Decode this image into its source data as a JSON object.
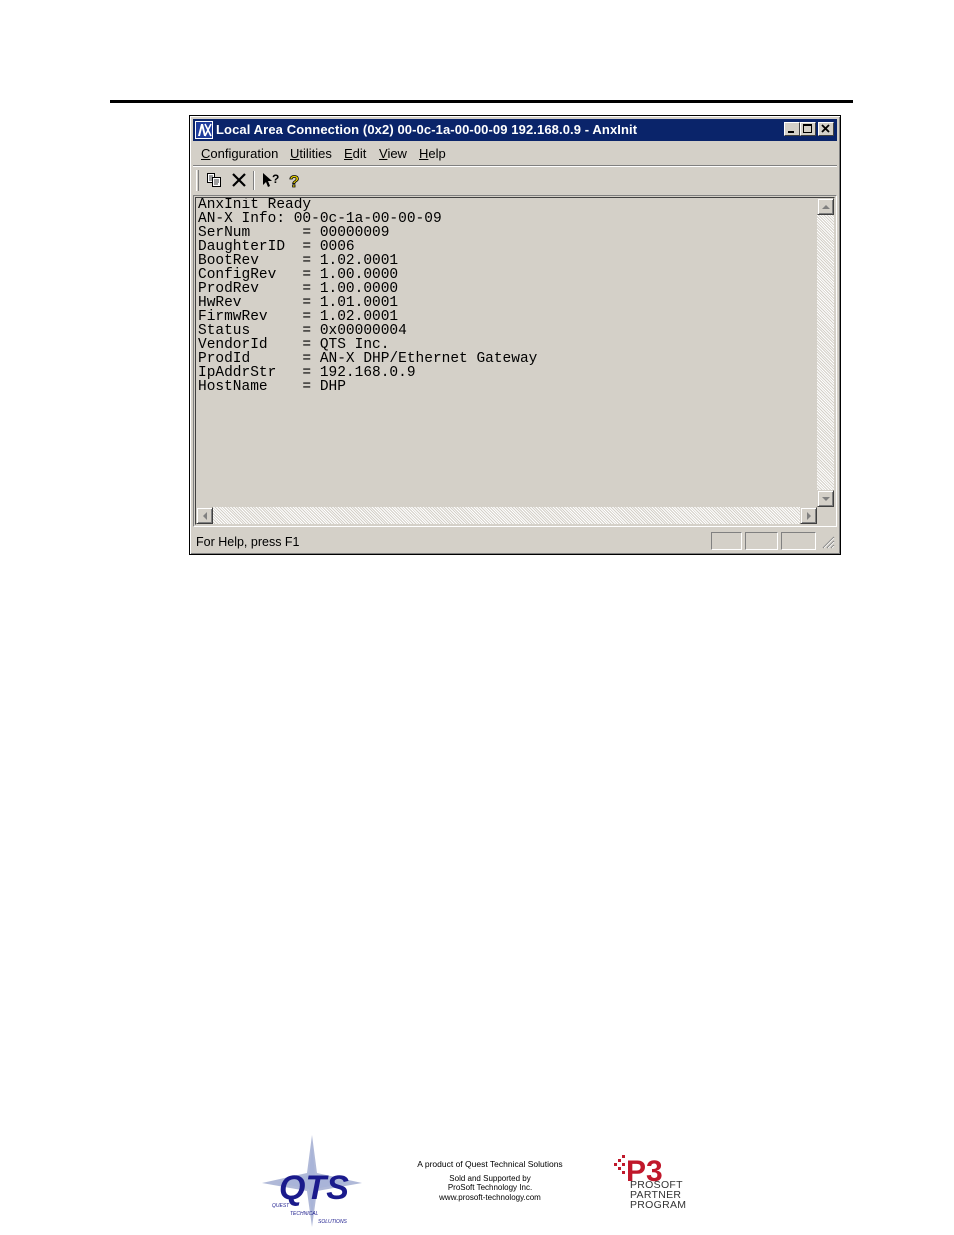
{
  "window": {
    "title": "Local Area Connection (0x2) 00-0c-1a-00-00-09  192.168.0.9 - AnxInit"
  },
  "menu": [
    {
      "pre": "",
      "key": "C",
      "post": "onfiguration"
    },
    {
      "pre": "",
      "key": "U",
      "post": "tilities"
    },
    {
      "pre": "",
      "key": "E",
      "post": "dit"
    },
    {
      "pre": "",
      "key": "V",
      "post": "iew"
    },
    {
      "pre": "",
      "key": "H",
      "post": "elp"
    }
  ],
  "toolbar": {
    "icons": [
      "copy-icon",
      "delete-icon",
      "context-help-icon",
      "help-icon"
    ]
  },
  "output": {
    "lines": [
      "AnxInit Ready",
      "AN-X Info: 00-0c-1a-00-00-09",
      "SerNum      = 00000009",
      "DaughterID  = 0006",
      "BootRev     = 1.02.0001",
      "ConfigRev   = 1.00.0000",
      "ProdRev     = 1.00.0000",
      "HwRev       = 1.01.0001",
      "FirmwRev    = 1.02.0001",
      "Status      = 0x00000004",
      "VendorId    = QTS Inc.",
      "ProdId      = AN-X DHP/Ethernet Gateway",
      "IpAddrStr   = 192.168.0.9",
      "HostName    = DHP"
    ]
  },
  "status": {
    "text": "For Help, press F1"
  },
  "footer": {
    "line1": "A product of Quest Technical Solutions",
    "line2": "Sold and Supported by",
    "line3": "ProSoft Technology Inc.",
    "line4": "www.prosoft-technology.com",
    "qts_logo_text": "QTS",
    "qts_logo_sub": [
      "QUEST",
      "TECHNICAL",
      "SOLUTIONS"
    ],
    "p3_logo": [
      "P3",
      "PROSOFT",
      "PARTNER",
      "PROGRAM"
    ]
  },
  "colors": {
    "titlebar": "#0a246a",
    "face": "#d4d0c8",
    "qts_blue": "#1a1a8c",
    "p3_red": "#c0182b"
  }
}
